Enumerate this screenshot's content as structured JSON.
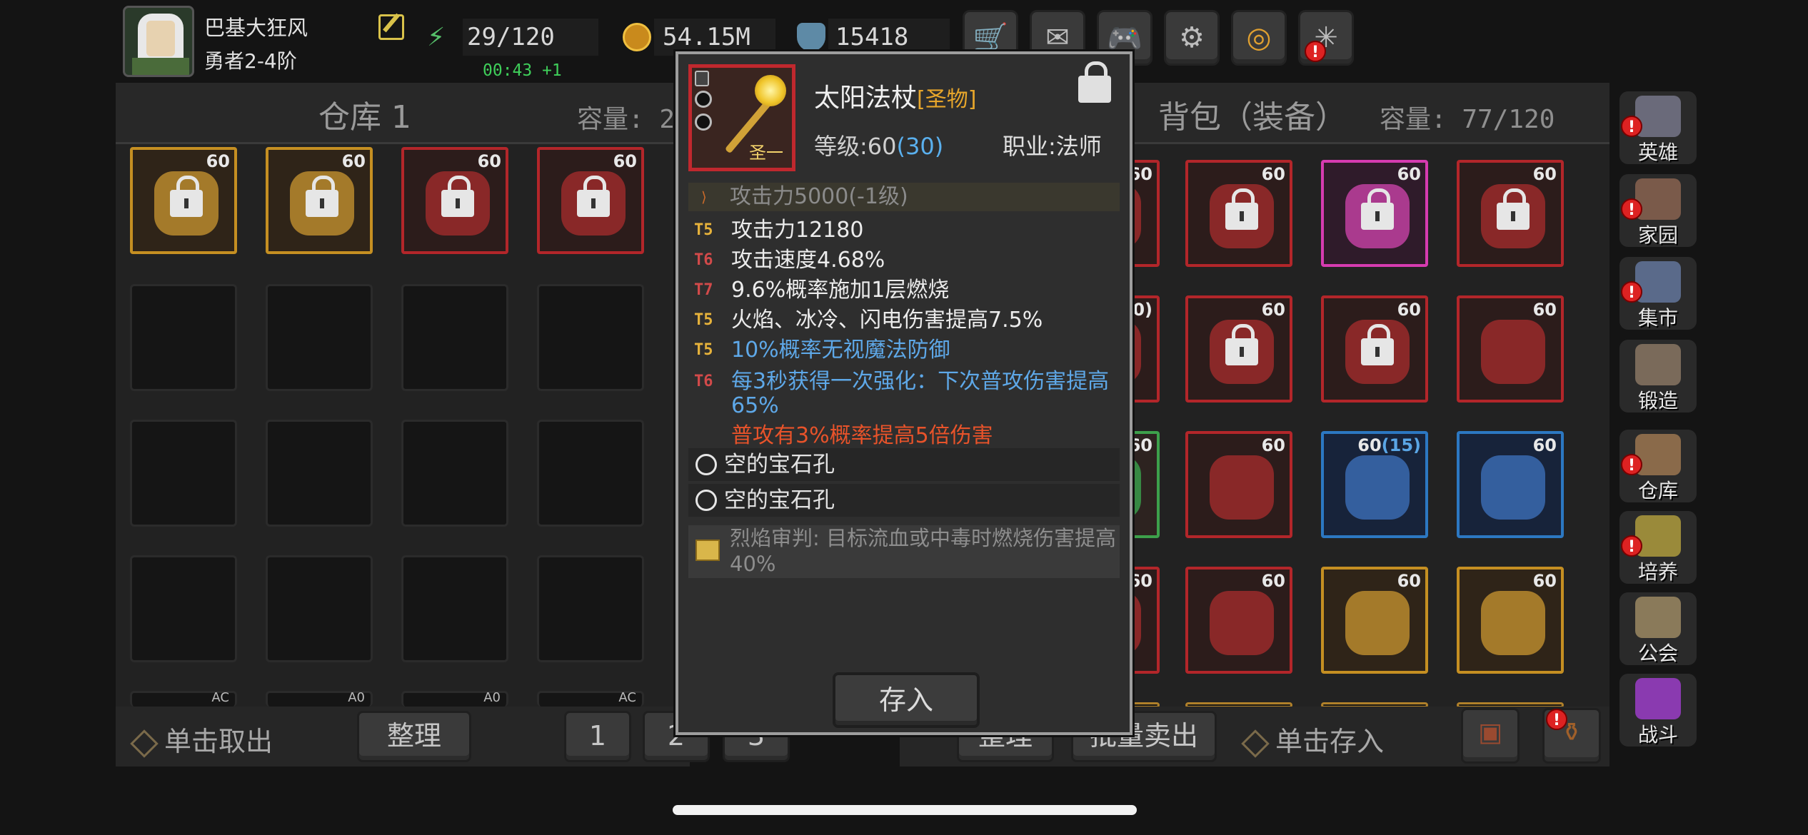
{
  "player": {
    "name": "巴基大狂风",
    "rank": "勇者2-4阶"
  },
  "resources": {
    "energy": "29/120",
    "energy_timer": "00:43 +1",
    "gold": "54.15M",
    "gems": "15418"
  },
  "top_buttons": [
    "shop",
    "mail",
    "gamepad",
    "settings",
    "camera",
    "fireworks"
  ],
  "warehouse": {
    "title": "仓库 1",
    "capacity": "容量: 2",
    "items": [
      {
        "level": "60",
        "rarity": "gold"
      },
      {
        "level": "60",
        "rarity": "gold"
      },
      {
        "level": "60",
        "rarity": "red"
      },
      {
        "level": "60",
        "rarity": "red"
      }
    ],
    "partial_labels": [
      "AC",
      "A0",
      "A0",
      "AC"
    ],
    "take_label": "单击取出",
    "sort_label": "整理",
    "pages": [
      "1",
      "2",
      "3"
    ]
  },
  "backpack": {
    "title": "背包（装备）",
    "capacity": "容量: 77/120",
    "items": [
      {
        "level": "60",
        "rarity": "red"
      },
      {
        "level": "60",
        "rarity": "red"
      },
      {
        "level": "60",
        "rarity": "pink"
      },
      {
        "level": "60",
        "rarity": "red"
      },
      {
        "level": "0)",
        "rarity": "red"
      },
      {
        "level": "60",
        "rarity": "red"
      },
      {
        "level": "60",
        "rarity": "red"
      },
      {
        "level": "60",
        "rarity": "red"
      },
      {
        "level": "60",
        "rarity": "green"
      },
      {
        "level": "60",
        "rarity": "red"
      },
      {
        "level": "60",
        "plus": "(15)",
        "rarity": "blue"
      },
      {
        "level": "60",
        "rarity": "blue"
      },
      {
        "level": "60",
        "rarity": "red"
      },
      {
        "level": "60",
        "rarity": "red"
      },
      {
        "level": "60",
        "rarity": "gold"
      },
      {
        "level": "60",
        "rarity": "gold"
      }
    ],
    "sort_label": "整理",
    "sell_label": "批量卖出",
    "store_label": "单击存入"
  },
  "nav": [
    {
      "label": "英雄",
      "icon": "helmet-icon",
      "alert": true
    },
    {
      "label": "家园",
      "icon": "castle-icon",
      "alert": true
    },
    {
      "label": "集市",
      "icon": "market-icon",
      "alert": true
    },
    {
      "label": "锻造",
      "icon": "anvil-icon",
      "alert": false
    },
    {
      "label": "仓库",
      "icon": "warehouse-icon",
      "alert": true
    },
    {
      "label": "培养",
      "icon": "trophy-icon",
      "alert": true
    },
    {
      "label": "公会",
      "icon": "guild-icon",
      "alert": false
    },
    {
      "label": "战斗",
      "icon": "portal-icon",
      "alert": false
    }
  ],
  "tooltip": {
    "name": "太阳法杖",
    "tag": "[圣物]",
    "icon_sub": "圣一",
    "level_label": "等级:",
    "level": "60",
    "level_bonus": "(30)",
    "job": "职业:法师",
    "base_stat": "攻击力5000(-1级)",
    "affixes": [
      {
        "tier": "T5",
        "text": "攻击力12180",
        "color": "white"
      },
      {
        "tier": "T6",
        "text": "攻击速度4.68%",
        "color": "white"
      },
      {
        "tier": "T7",
        "text": "9.6%概率施加1层燃烧",
        "color": "white"
      },
      {
        "tier": "T5",
        "text": "火焰、冰冷、闪电伤害提高7.5%",
        "color": "white"
      },
      {
        "tier": "T5",
        "text": "10%概率无视魔法防御",
        "color": "blue"
      },
      {
        "tier": "T6",
        "text": "每3秒获得一次强化：下次普攻伤害提高65%",
        "color": "blue"
      },
      {
        "tier": "",
        "text": "普攻有3%概率提高5倍伤害",
        "color": "orange"
      }
    ],
    "sockets": [
      "空的宝石孔",
      "空的宝石孔"
    ],
    "set_text": "烈焰审判: 目标流血或中毒时燃烧伤害提高40%",
    "deposit_label": "存入"
  }
}
